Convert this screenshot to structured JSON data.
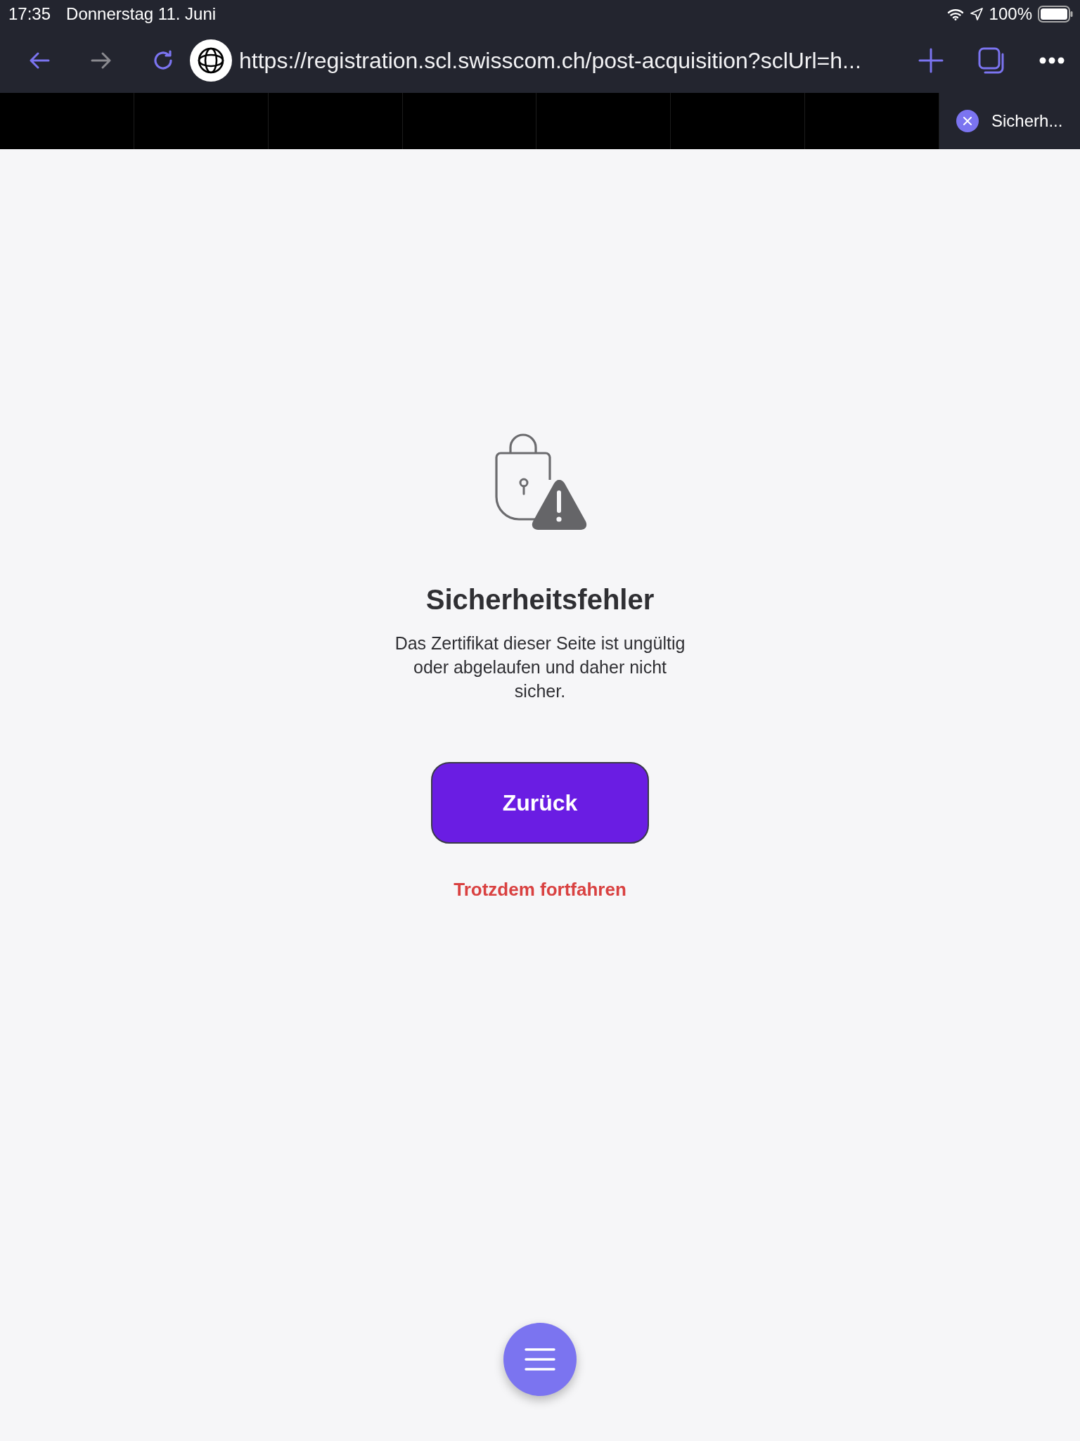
{
  "status_bar": {
    "time": "17:35",
    "date": "Donnerstag 11. Juni",
    "battery": "100%"
  },
  "toolbar": {
    "url": "https://registration.scl.swisscom.ch/post-acquisition?sclUrl=h..."
  },
  "tabs": [
    {
      "label": "Sicherh...",
      "selected": true
    }
  ],
  "page": {
    "title": "Sicherheitsfehler",
    "message": "Das Zertifikat dieser Seite ist ungültig oder abgelaufen und daher nicht sicher.",
    "primary_button": "Zurück",
    "link": "Trotzdem fortfahren"
  }
}
